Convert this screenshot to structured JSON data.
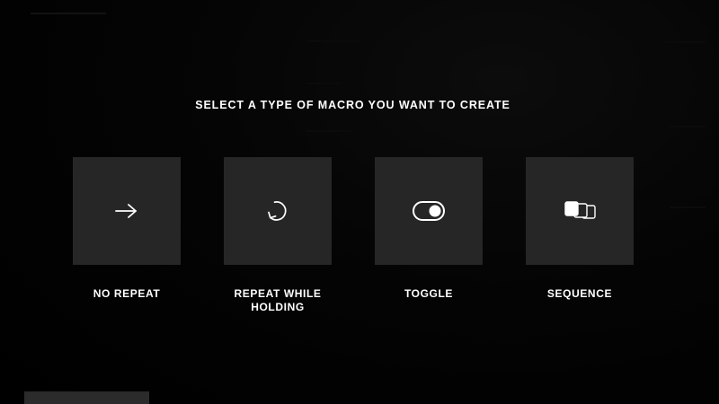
{
  "prompt": "SELECT A TYPE OF MACRO YOU WANT TO CREATE",
  "options": [
    {
      "label": "NO REPEAT",
      "icon": "arrow-right-icon"
    },
    {
      "label": "REPEAT WHILE HOLDING",
      "icon": "repeat-circular-arrow-icon"
    },
    {
      "label": "TOGGLE",
      "icon": "toggle-switch-icon"
    },
    {
      "label": "SEQUENCE",
      "icon": "sequence-stacked-squares-icon"
    }
  ],
  "colors": {
    "background": "#000000",
    "tile": "#262626",
    "text": "#ffffff"
  }
}
